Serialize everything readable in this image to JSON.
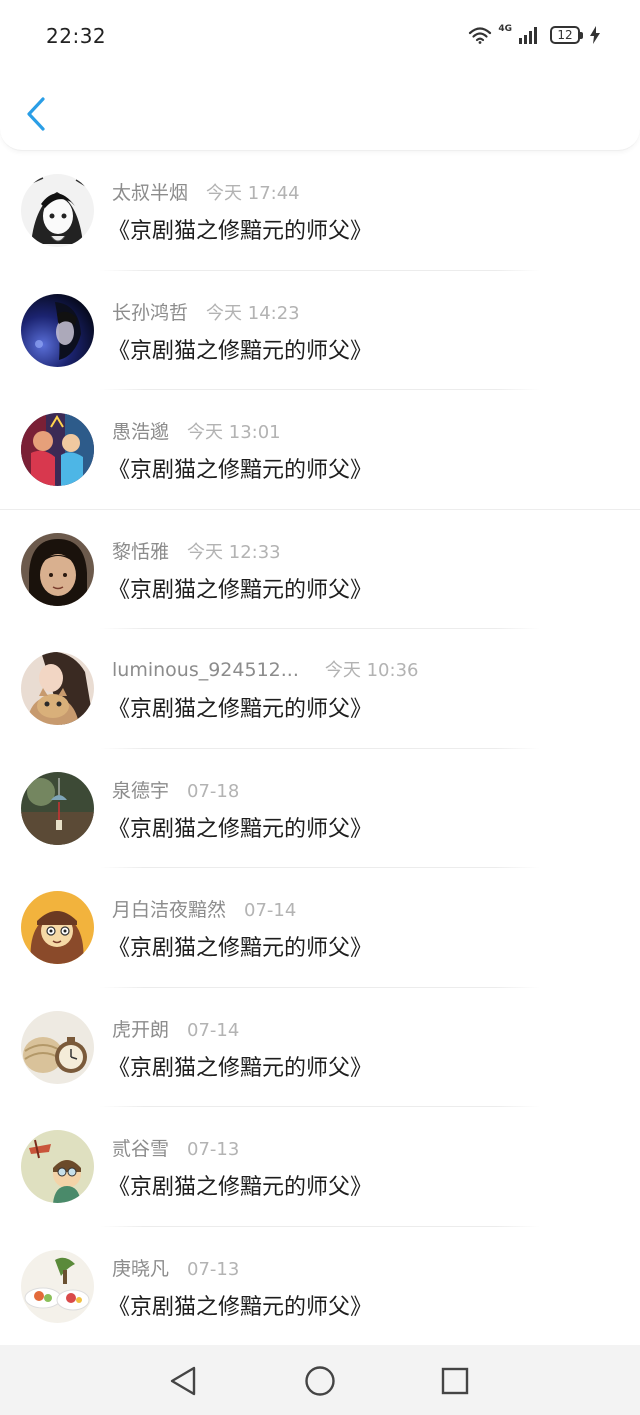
{
  "status_bar": {
    "time": "22:32",
    "network": "4G",
    "battery_level": "12",
    "icons": [
      "wifi-icon",
      "cellular-signal-icon",
      "battery-icon",
      "charging-icon"
    ]
  },
  "header": {
    "back_icon": "chevron-left-icon",
    "accent_color": "#2a9ee6"
  },
  "items": [
    {
      "name": "太叔半烟",
      "time": "今天 17:44",
      "content": "《京剧猫之修黯元的师父》",
      "avatar": "anime-girl"
    },
    {
      "name": "长孙鸿哲",
      "time": "今天 14:23",
      "content": "《京剧猫之修黯元的师父》",
      "avatar": "night-portrait"
    },
    {
      "name": "愚浩邈",
      "time": "今天 13:01",
      "content": "《京剧猫之修黯元的师父》",
      "avatar": "colorful-art"
    },
    {
      "name": "黎恬雅",
      "time": "今天 12:33",
      "content": "《京剧猫之修黯元的师父》",
      "avatar": "girl-face"
    },
    {
      "name": "luminous_924512...",
      "time": "今天 10:36",
      "content": "《京剧猫之修黯元的师父》",
      "avatar": "cat-photo"
    },
    {
      "name": "泉德宇",
      "time": "07-18",
      "content": "《京剧猫之修黯元的师父》",
      "avatar": "wind-chime"
    },
    {
      "name": "月白洁夜黯然",
      "time": "07-14",
      "content": "《京剧猫之修黯元的师父》",
      "avatar": "cartoon-character"
    },
    {
      "name": "虎开朗",
      "time": "07-14",
      "content": "《京剧猫之修黯元的师父》",
      "avatar": "pocket-watch"
    },
    {
      "name": "贰谷雪",
      "time": "07-13",
      "content": "《京剧猫之修黯元的师父》",
      "avatar": "pilot-cartoon"
    },
    {
      "name": "庚晓凡",
      "time": "07-13",
      "content": "《京剧猫之修黯元的师父》",
      "avatar": "food-plate"
    }
  ],
  "navbar": {
    "back_icon": "triangle-back-icon",
    "home_icon": "circle-home-icon",
    "recents_icon": "square-recents-icon"
  }
}
